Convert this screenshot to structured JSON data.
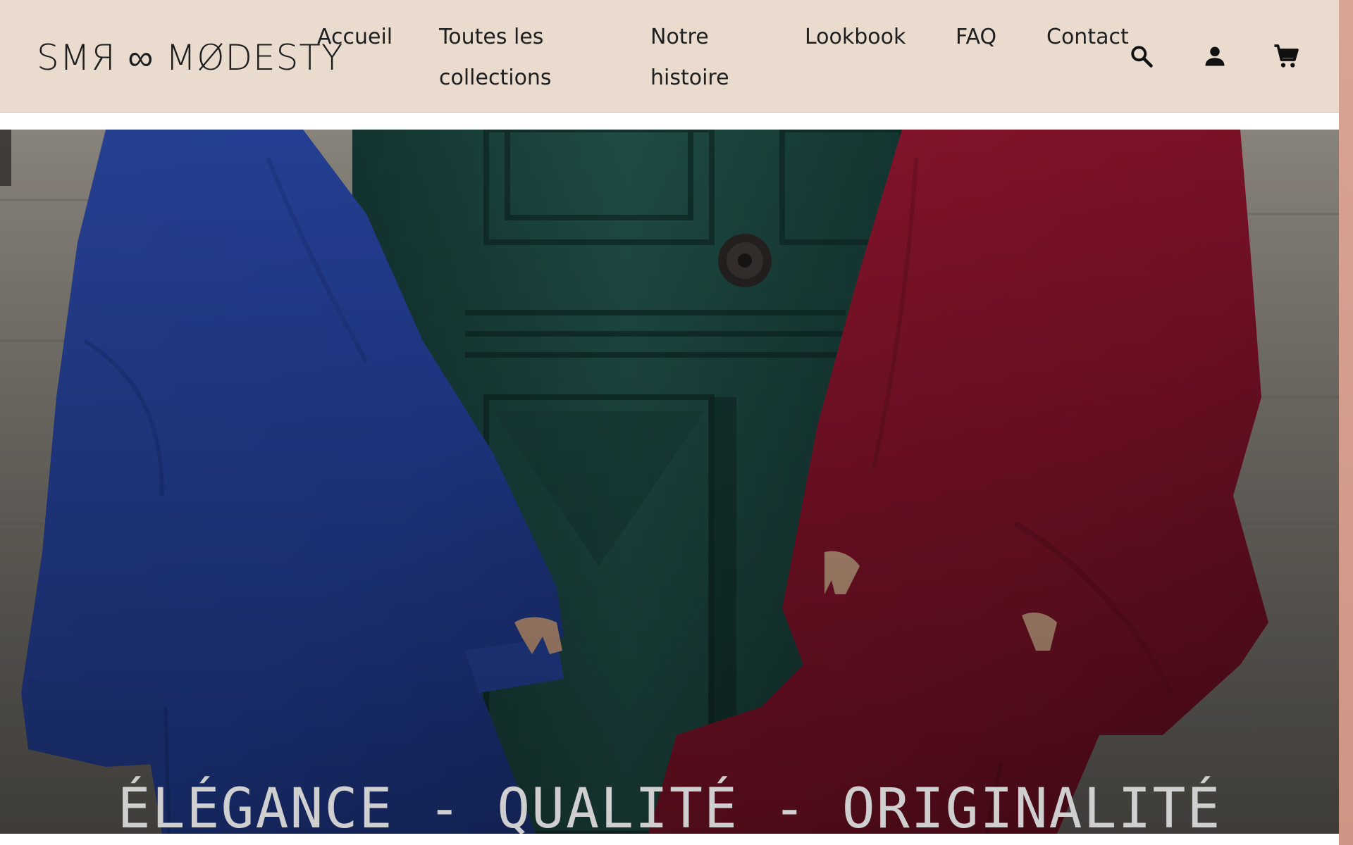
{
  "brand": {
    "logo_text": "SMЯ ∞ MØDESTY"
  },
  "nav": {
    "items": [
      {
        "label": "Accueil"
      },
      {
        "label": "Toutes les collections"
      },
      {
        "label": "Notre histoire"
      },
      {
        "label": "Lookbook"
      },
      {
        "label": "FAQ"
      },
      {
        "label": "Contact"
      }
    ]
  },
  "header_icons": {
    "search": "search-icon",
    "account": "account-icon",
    "cart": "cart-icon"
  },
  "hero": {
    "tagline": "ÉLÉGANCE - QUALITÉ - ORIGINALITÉ",
    "image_subject": "two women in blue and red knit sweaters and trousers in front of a green door"
  },
  "colors": {
    "header_bg": "#e9dbce",
    "text_dark": "#1f1f1f",
    "accent_strip": "#d7a496",
    "sweater_blue": "#2f4fb3",
    "sweater_red": "#96172f",
    "door_green": "#1d4a44"
  }
}
